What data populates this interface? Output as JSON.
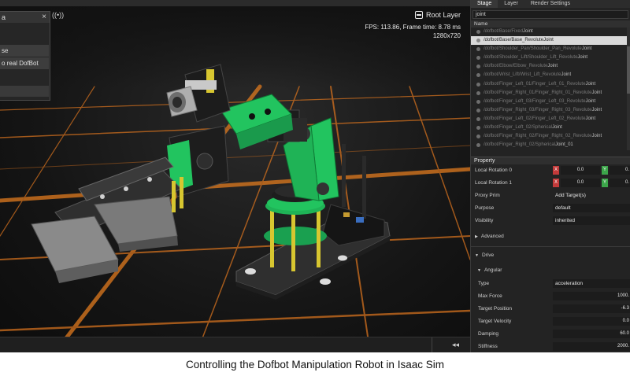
{
  "viewport": {
    "tools_label": "((•))",
    "root_layer_label": "Root Layer",
    "fps_text": "FPS: 113.86, Frame time: 8.78 ms",
    "resolution_text": "1280x720",
    "rewind_label": "◂◂"
  },
  "dialog": {
    "title": "a",
    "close_label": "×",
    "buttons": [
      "se",
      "o real DofBot"
    ]
  },
  "stage": {
    "tabs": [
      "Stage",
      "Layer",
      "Render Settings"
    ],
    "search_value": "joint",
    "column_header": "Name",
    "items": [
      {
        "path": "/dofbot/Base/Fixed",
        "suffix": "Joint"
      },
      {
        "path": "/dofbot/Base/Base_Revolute",
        "suffix": "Joint"
      },
      {
        "path": "/dofbot/Shoulder_Pan/Shoulder_Pan_Revolute",
        "suffix": "Joint"
      },
      {
        "path": "/dofbot/Shoulder_Lift/Shoulder_Lift_Revolute",
        "suffix": "Joint"
      },
      {
        "path": "/dofbot/Elbow/Elbow_Revolute",
        "suffix": "Joint"
      },
      {
        "path": "/dofbot/Wrist_Lift/Wrist_Lift_Revolute",
        "suffix": "Joint"
      },
      {
        "path": "/dofbot/Finger_Left_01/Finger_Left_01_Revolute",
        "suffix": "Joint"
      },
      {
        "path": "/dofbot/Finger_Right_01/Finger_Right_01_Revolute",
        "suffix": "Joint"
      },
      {
        "path": "/dofbot/Finger_Left_03/Finger_Left_03_Revolute",
        "suffix": "Joint"
      },
      {
        "path": "/dofbot/Finger_Right_03/Finger_Right_03_Revolute",
        "suffix": "Joint"
      },
      {
        "path": "/dofbot/Finger_Left_02/Finger_Left_02_Revolute",
        "suffix": "Joint"
      },
      {
        "path": "/dofbot/Finger_Left_02/Spherical",
        "suffix": "Joint"
      },
      {
        "path": "/dofbot/Finger_Right_02/Finger_Right_02_Revolute",
        "suffix": "Joint"
      },
      {
        "path": "/dofbot/Finger_Right_02/Spherical",
        "suffix": "Joint_01"
      }
    ]
  },
  "property": {
    "header": "Property",
    "rot0_label": "Local Rotation 0",
    "rot1_label": "Local Rotation 1",
    "x_axis": "X",
    "y_axis": "Y",
    "rot0_x": "0.0",
    "rot0_y": "0.",
    "rot1_x": "0.0",
    "rot1_y": "0.",
    "proxy_label": "Proxy Prim",
    "proxy_value": "Add Target(s)",
    "purpose_label": "Purpose",
    "purpose_value": "default",
    "visibility_label": "Visibility",
    "visibility_value": "inherited",
    "advanced_label": "Advanced",
    "drive_label": "Drive",
    "angular_label": "Angular",
    "type_label": "Type",
    "type_value": "acceleration",
    "max_force_label": "Max Force",
    "max_force_value": "1000.",
    "target_pos_label": "Target Position",
    "target_pos_value": "-6.3",
    "target_vel_label": "Target Velocity",
    "target_vel_value": "0.0",
    "damping_label": "Damping",
    "damping_value": "60.0",
    "stiffness_label": "Stiffness",
    "stiffness_value": "2000."
  },
  "caption": "Controlling the Dofbot Manipulation Robot in Isaac Sim"
}
